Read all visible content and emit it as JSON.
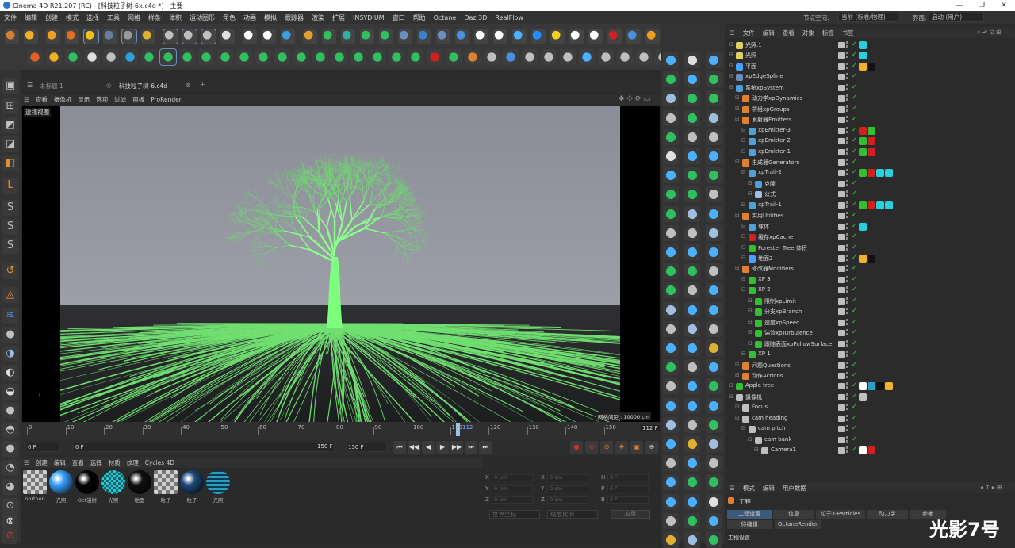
{
  "window": {
    "title": "Cinema 4D R21.207 (RC) - [科技粒子树-6x.c4d *] - 主要",
    "controls": [
      "—",
      "❐",
      "✕"
    ]
  },
  "menubar": [
    "文件",
    "编辑",
    "创建",
    "模式",
    "选择",
    "工具",
    "网格",
    "样条",
    "体积",
    "运动图形",
    "角色",
    "动画",
    "模拟",
    "跟踪器",
    "渲染",
    "扩展",
    "INSYDIUM",
    "窗口",
    "帮助",
    "Octane",
    "Daz 3D",
    "RealFlow"
  ],
  "layout": {
    "interface_label": "节点空间:",
    "interface_value": "当前 (标准/物理)",
    "layout_label": "界面:",
    "layout_value": "启动 (用户)"
  },
  "viewport": {
    "tabs": [
      "未标题 1",
      "科技粒子树-6.c4d"
    ],
    "menu": [
      "查看",
      "摄像机",
      "显示",
      "选项",
      "过滤",
      "面板",
      "ProRender"
    ],
    "view_name": "透视视图",
    "grid_spacing": "网格间距 : 10000 cm"
  },
  "timeline": {
    "ticks": [
      "0",
      "10",
      "20",
      "30",
      "40",
      "50",
      "60",
      "70",
      "80",
      "90",
      "100",
      "110",
      "120",
      "130",
      "140",
      "150"
    ],
    "current_frame": "112",
    "end_label": "112 F",
    "start_field": "0 F",
    "current_field": "0 F",
    "end_field1": "150 F",
    "end_field2": "150 F"
  },
  "material_manager": {
    "menu": [
      "创建",
      "编辑",
      "查看",
      "选择",
      "材质",
      "纹理",
      "Cycles 4D"
    ],
    "materials": [
      {
        "name": "northen",
        "color": "#d0d0d0",
        "kind": "checker"
      },
      {
        "name": "光照",
        "color": "#3aa0ff",
        "kind": "sphere"
      },
      {
        "name": "Oct漫射",
        "color": "#050505",
        "kind": "sphere"
      },
      {
        "name": "光照",
        "color": "#29c9c9",
        "kind": "pixel"
      },
      {
        "name": "地面",
        "color": "#101010",
        "kind": "sphere"
      },
      {
        "name": "粒子",
        "color": "#cfcfcf",
        "kind": "checker"
      },
      {
        "name": "粒子",
        "color": "#1e4a7a",
        "kind": "sphere"
      },
      {
        "name": "光照",
        "color": "#2a9ec0",
        "kind": "stripe"
      }
    ]
  },
  "coordinates": {
    "rows": [
      {
        "a": "X",
        "v1": "0 cm",
        "b": "X",
        "v2": "0 cm",
        "c": "H",
        "v3": "0 °"
      },
      {
        "a": "Y",
        "v1": "0 cm",
        "b": "Y",
        "v2": "0 cm",
        "c": "P",
        "v3": "0 °"
      },
      {
        "a": "Z",
        "v1": "0 cm",
        "b": "Z",
        "v2": "0 cm",
        "c": "B",
        "v3": "0 °"
      }
    ],
    "mode1": "世界坐标",
    "mode2": "缩放比例",
    "apply": "应用"
  },
  "object_manager": {
    "menu": [
      "文件",
      "编辑",
      "查看",
      "对象",
      "标签",
      "书签"
    ],
    "objects": [
      {
        "name": "光照.1",
        "indent": 0,
        "icon": "#e0d060",
        "tags": [
          "#29d0e0"
        ]
      },
      {
        "name": "光照",
        "indent": 0,
        "icon": "#e0d060",
        "tags": [
          "#29d0e0"
        ]
      },
      {
        "name": "平面",
        "indent": 0,
        "icon": "#4aa0ff",
        "tags": [
          "#f0b030",
          "#111111"
        ]
      },
      {
        "name": "xpEdgeSpline",
        "indent": 0,
        "icon": "#6a8fbf",
        "tags": []
      },
      {
        "name": "系统xpSystem",
        "indent": 0,
        "icon": "#4fa0d8",
        "tags": []
      },
      {
        "name": "动力学xpDynamics",
        "indent": 1,
        "icon": "#e08030",
        "tags": []
      },
      {
        "name": "群组xpGroups",
        "indent": 1,
        "icon": "#e08030",
        "tags": []
      },
      {
        "name": "发射器Emitters",
        "indent": 1,
        "icon": "#e08030",
        "tags": []
      },
      {
        "name": "xpEmitter-3",
        "indent": 2,
        "icon": "#4fa0d8",
        "tags": [
          "#d02020",
          "#30c030"
        ]
      },
      {
        "name": "xpEmitter-2",
        "indent": 2,
        "icon": "#4fa0d8",
        "tags": [
          "#30c030",
          "#d02020"
        ]
      },
      {
        "name": "xpEmitter-1",
        "indent": 2,
        "icon": "#4fa0d8",
        "tags": [
          "#30c030",
          "#d02020"
        ]
      },
      {
        "name": "生成器Generators",
        "indent": 1,
        "icon": "#e08030",
        "tags": []
      },
      {
        "name": "xpTrail-2",
        "indent": 2,
        "icon": "#4fa0d8",
        "tags": [
          "#30c030",
          "#d02020",
          "#29d0e0",
          "#29d0e0"
        ]
      },
      {
        "name": "克隆",
        "indent": 3,
        "icon": "#4fa0d8",
        "tags": []
      },
      {
        "name": "公式",
        "indent": 3,
        "icon": "#9fbfe0",
        "tags": []
      },
      {
        "name": "xpTrail-1",
        "indent": 2,
        "icon": "#4fa0d8",
        "tags": [
          "#30c030",
          "#d02020",
          "#29d0e0",
          "#29d0e0"
        ]
      },
      {
        "name": "实用Utilities",
        "indent": 1,
        "icon": "#e08030",
        "tags": []
      },
      {
        "name": "球体",
        "indent": 2,
        "icon": "#4fa0d8",
        "tags": [
          "#29d0e0"
        ]
      },
      {
        "name": "缓存xpCache",
        "indent": 2,
        "icon": "#d02020",
        "tags": []
      },
      {
        "name": "Forester Tree 体积",
        "indent": 2,
        "icon": "#30c030",
        "tags": []
      },
      {
        "name": "地面2",
        "indent": 2,
        "icon": "#4aa0ff",
        "tags": [
          "#f0b030",
          "#111111"
        ]
      },
      {
        "name": "修改器Modifiers",
        "indent": 1,
        "icon": "#e08030",
        "tags": []
      },
      {
        "name": "XP 3",
        "indent": 2,
        "icon": "#30c030",
        "tags": []
      },
      {
        "name": "XP 2",
        "indent": 2,
        "icon": "#30c030",
        "tags": []
      },
      {
        "name": "限制xpLimit",
        "indent": 3,
        "icon": "#30c030",
        "tags": []
      },
      {
        "name": "分支xpBranch",
        "indent": 3,
        "icon": "#30c030",
        "tags": []
      },
      {
        "name": "速度xpSpeed",
        "indent": 3,
        "icon": "#30c030",
        "tags": []
      },
      {
        "name": "湍流xpTurbulence",
        "indent": 3,
        "icon": "#30c030",
        "tags": []
      },
      {
        "name": "跟随表面xpFollowSurface",
        "indent": 3,
        "icon": "#30c030",
        "tags": []
      },
      {
        "name": "XP 1",
        "indent": 2,
        "icon": "#30c030",
        "tags": []
      },
      {
        "name": "问题Questions",
        "indent": 1,
        "icon": "#e08030",
        "tags": []
      },
      {
        "name": "动作Actions",
        "indent": 1,
        "icon": "#e08030",
        "tags": []
      },
      {
        "name": "Apple tree",
        "indent": 0,
        "icon": "#30c030",
        "tags": [
          "#ffffff",
          "#29a0c0",
          "#111111",
          "#f0b030"
        ]
      },
      {
        "name": "摄像机",
        "indent": 0,
        "icon": "#bfbfbf",
        "tags": [
          "#bfbfbf"
        ]
      },
      {
        "name": "Focus",
        "indent": 1,
        "icon": "#bfbfbf",
        "tags": []
      },
      {
        "name": "cam heading",
        "indent": 1,
        "icon": "#bfbfbf",
        "tags": []
      },
      {
        "name": "cam pitch",
        "indent": 2,
        "icon": "#bfbfbf",
        "tags": []
      },
      {
        "name": "cam bank",
        "indent": 3,
        "icon": "#bfbfbf",
        "tags": []
      },
      {
        "name": "Camera1",
        "indent": 4,
        "icon": "#bfbfbf",
        "tags": [
          "#ffffff",
          "#d02020"
        ]
      }
    ]
  },
  "attribute_manager": {
    "menu": [
      "模式",
      "编辑",
      "用户数据"
    ],
    "title": "工程",
    "tabs": [
      "工程设置",
      "信息",
      "粒子X-Particles",
      "动力学",
      "参考"
    ],
    "tabs2": [
      "待编辑",
      "OctaneRender"
    ],
    "section": "工程设置"
  },
  "watermark": "光影7号"
}
